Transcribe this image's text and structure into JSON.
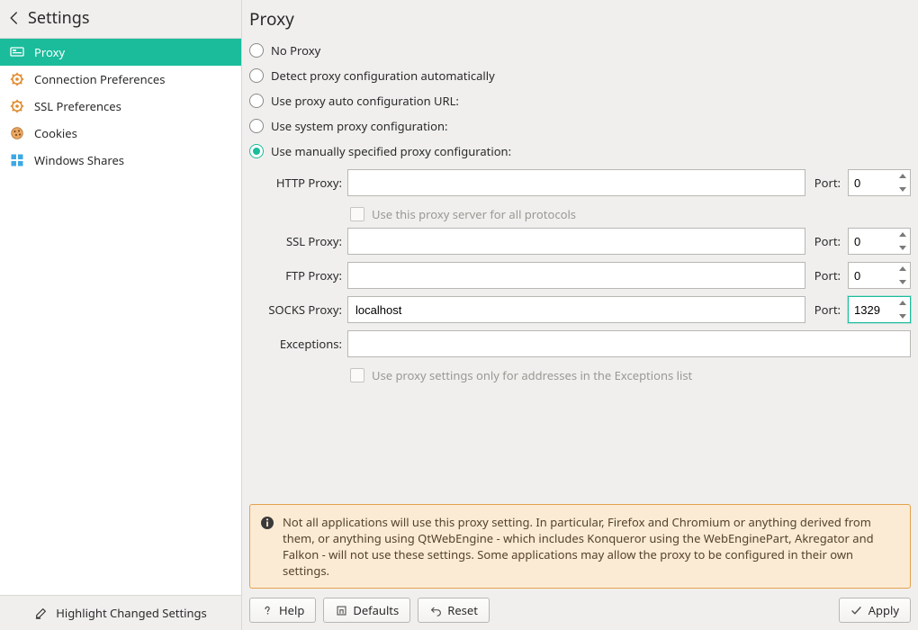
{
  "sidebar": {
    "title": "Settings",
    "items": [
      {
        "label": "Proxy",
        "icon": "network-icon",
        "selected": true
      },
      {
        "label": "Connection Preferences",
        "icon": "gear-icon",
        "selected": false
      },
      {
        "label": "SSL Preferences",
        "icon": "gear-icon",
        "selected": false
      },
      {
        "label": "Cookies",
        "icon": "cookie-icon",
        "selected": false
      },
      {
        "label": "Windows Shares",
        "icon": "shares-icon",
        "selected": false
      }
    ],
    "footer_label": "Highlight Changed Settings"
  },
  "page": {
    "title": "Proxy",
    "radios": [
      {
        "id": "no-proxy",
        "label": "No Proxy",
        "checked": false
      },
      {
        "id": "detect-auto",
        "label": "Detect proxy configuration automatically",
        "checked": false
      },
      {
        "id": "pac-url",
        "label": "Use proxy auto configuration URL:",
        "checked": false
      },
      {
        "id": "system",
        "label": "Use system proxy configuration:",
        "checked": false
      },
      {
        "id": "manual",
        "label": "Use manually specified proxy configuration:",
        "checked": true
      }
    ],
    "form": {
      "http": {
        "label": "HTTP Proxy:",
        "host": "",
        "port_label": "Port:",
        "port": "0"
      },
      "all_protocols_label": "Use this proxy server for all protocols",
      "ssl": {
        "label": "SSL Proxy:",
        "host": "",
        "port_label": "Port:",
        "port": "0"
      },
      "ftp": {
        "label": "FTP Proxy:",
        "host": "",
        "port_label": "Port:",
        "port": "0"
      },
      "socks": {
        "label": "SOCKS Proxy:",
        "host": "localhost",
        "port_label": "Port:",
        "port": "1329",
        "focused": true
      },
      "exceptions": {
        "label": "Exceptions:",
        "value": ""
      },
      "exceptions_only_label": "Use proxy settings only for addresses in the Exceptions list"
    },
    "info": "Not all applications will use this proxy setting. In particular, Firefox and Chromium or anything derived from them, or anything using QtWebEngine - which includes Konqueror using the WebEnginePart, Akregator and Falkon - will not use these settings. Some applications may allow the proxy to be configured in their own settings.",
    "buttons": {
      "help": "Help",
      "defaults": "Defaults",
      "reset": "Reset",
      "apply": "Apply"
    }
  },
  "colors": {
    "accent": "#1abc9c",
    "info_border": "#e4a24d",
    "info_bg": "#fcebd4"
  }
}
